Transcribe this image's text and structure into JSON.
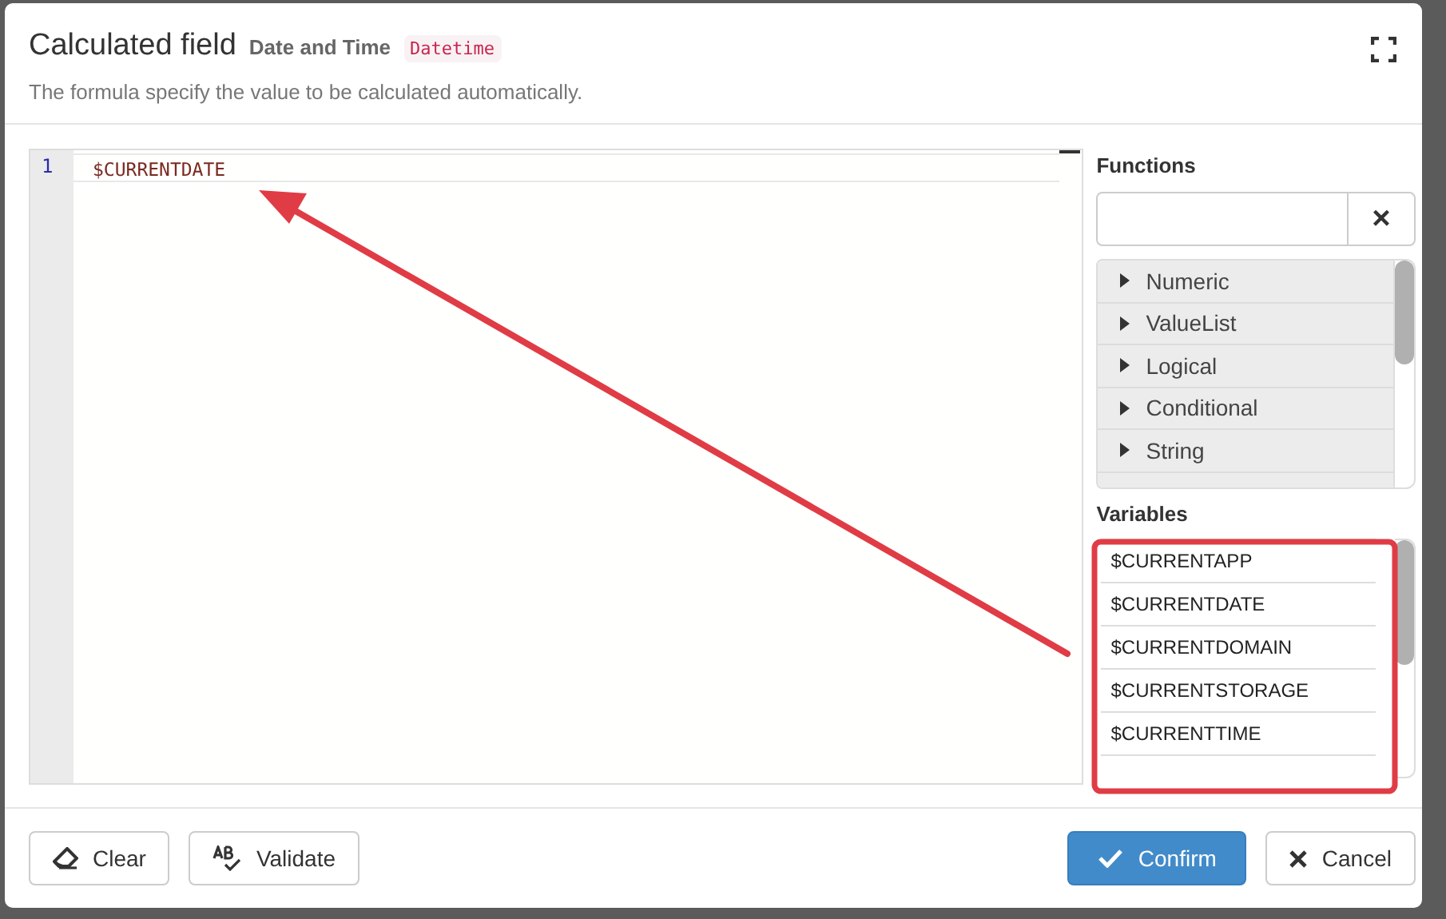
{
  "dialog": {
    "title": "Calculated field",
    "field_name": "Date and Time",
    "field_type": "Datetime",
    "description": "The formula specify the value to be calculated automatically."
  },
  "editor": {
    "lines": [
      {
        "number": "1",
        "code": "$CURRENTDATE"
      }
    ]
  },
  "functions": {
    "heading": "Functions",
    "clear_label": "×",
    "groups": [
      {
        "label": "Numeric",
        "expanded": false
      },
      {
        "label": "ValueList",
        "expanded": false
      },
      {
        "label": "Logical",
        "expanded": false
      },
      {
        "label": "Conditional",
        "expanded": false
      },
      {
        "label": "String",
        "expanded": false
      }
    ]
  },
  "variables": {
    "heading": "Variables",
    "items": [
      "$CURRENTAPP",
      "$CURRENTDATE",
      "$CURRENTDOMAIN",
      "$CURRENTSTORAGE",
      "$CURRENTTIME"
    ]
  },
  "footer": {
    "left_buttons": [
      {
        "kind": "clear",
        "label": "Clear"
      },
      {
        "kind": "validate",
        "label": "Validate"
      }
    ],
    "right_buttons": [
      {
        "kind": "confirm",
        "label": "Confirm",
        "primary": true
      },
      {
        "kind": "cancel",
        "label": "Cancel",
        "primary": false
      }
    ]
  },
  "annotations": {
    "arrow": true,
    "highlight_frame": true
  }
}
